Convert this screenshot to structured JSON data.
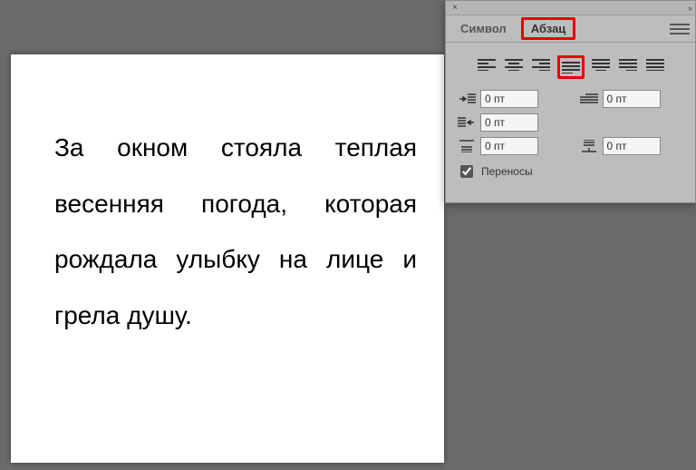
{
  "document": {
    "text": "За окном стояла теплая весенняя погода, которая рождала улыбку на лице и грела душу."
  },
  "panel": {
    "tabs": {
      "symbol": "Символ",
      "paragraph": "Абзац"
    },
    "fields": {
      "indent_left": "0 пт",
      "first_line": "0 пт",
      "indent_right": "0 пт",
      "space_before": "0 пт",
      "space_after": "0 пт"
    },
    "hyphenation_label": "Переносы"
  }
}
